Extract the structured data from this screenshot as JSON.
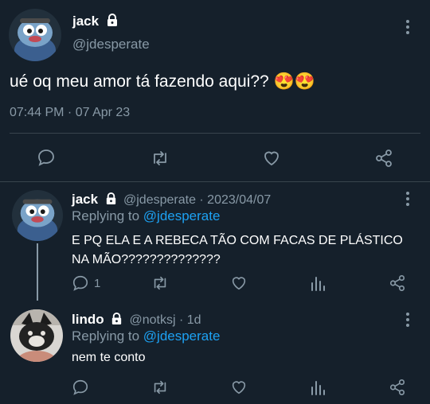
{
  "main_tweet": {
    "name": "jack",
    "handle": "@jdesperate",
    "text": "ué oq meu amor tá fazendo aqui?? 😍😍",
    "timestamp": "07:44 PM · 07 Apr 23"
  },
  "reply1": {
    "name": "jack",
    "meta": "@jdesperate · 2023/04/07",
    "replying_prefix": "Replying to ",
    "replying_handle": "@jdesperate",
    "text_line1": "E PQ ELA E A REBECA TÃO COM FACAS DE PLÁSTICO",
    "text_line2": "NA MÃO??????????????",
    "reply_count": "1"
  },
  "reply2": {
    "name": "lindo",
    "meta": "@notksj · 1d",
    "replying_prefix": "Replying to ",
    "replying_handle": "@jdesperate",
    "text": "nem te conto"
  },
  "colors": {
    "background": "#15202b",
    "muted": "#8899a6",
    "link": "#1da1f2",
    "divider": "#38444d"
  },
  "icons": [
    "lock-icon",
    "more-icon",
    "reply-icon",
    "retweet-icon",
    "like-icon",
    "share-icon",
    "analytics-icon"
  ]
}
